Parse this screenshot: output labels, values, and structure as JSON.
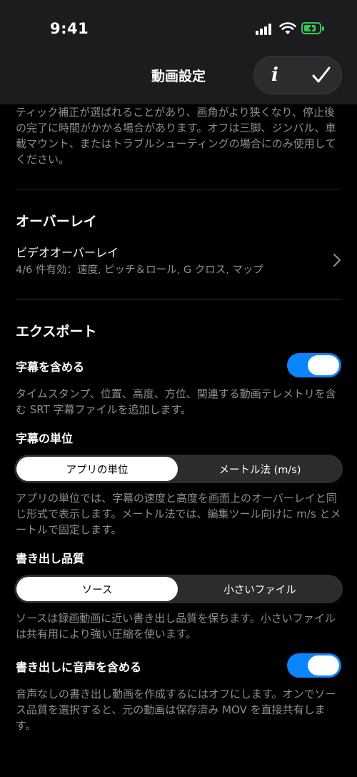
{
  "status_bar": {
    "time": "9:41"
  },
  "nav": {
    "title": "動画設定",
    "info_label": "i"
  },
  "top_description": "ティック補正が選ばれることがあり、画角がより狭くなり、停止後の完了に時間がかかる場合があります。オフは三脚、ジンバル、車載マウント、またはトラブルシューティングの場合にのみ使用してください。",
  "overlay": {
    "section_title": "オーバーレイ",
    "video_overlay_title": "ビデオオーバーレイ",
    "video_overlay_subtitle": "4/6 件有効：速度, ピッチ＆ロール, G クロス, マップ"
  },
  "export": {
    "section_title": "エクスポート",
    "subtitles": {
      "label": "字幕を含める",
      "enabled": true,
      "description": "タイムスタンプ、位置、高度、方位、関連する動画テレメトリを含む SRT 字幕ファイルを追加します。"
    },
    "subtitle_units": {
      "label": "字幕の単位",
      "options": [
        "アプリの単位",
        "メートル法 (m/s)"
      ],
      "selected": "アプリの単位",
      "description": "アプリの単位では、字幕の速度と高度を画面上のオーバーレイと同じ形式で表示します。メートル法では、編集ツール向けに m/s とメートルで固定します。"
    },
    "quality": {
      "label": "書き出し品質",
      "options": [
        "ソース",
        "小さいファイル"
      ],
      "selected": "ソース",
      "description": "ソースは録画動画に近い書き出し品質を保ちます。小さいファイルは共有用により強い圧縮を使います。"
    },
    "audio": {
      "label": "書き出しに音声を含める",
      "enabled": true,
      "description": "音声なしの書き出し動画を作成するにはオフにします。オンでソース品質を選択すると、元の動画は保存済み MOV を直接共有します。"
    }
  },
  "colors": {
    "accent": "#0a84ff",
    "battery": "#34c759",
    "secondary_text": "#8e8e93"
  }
}
